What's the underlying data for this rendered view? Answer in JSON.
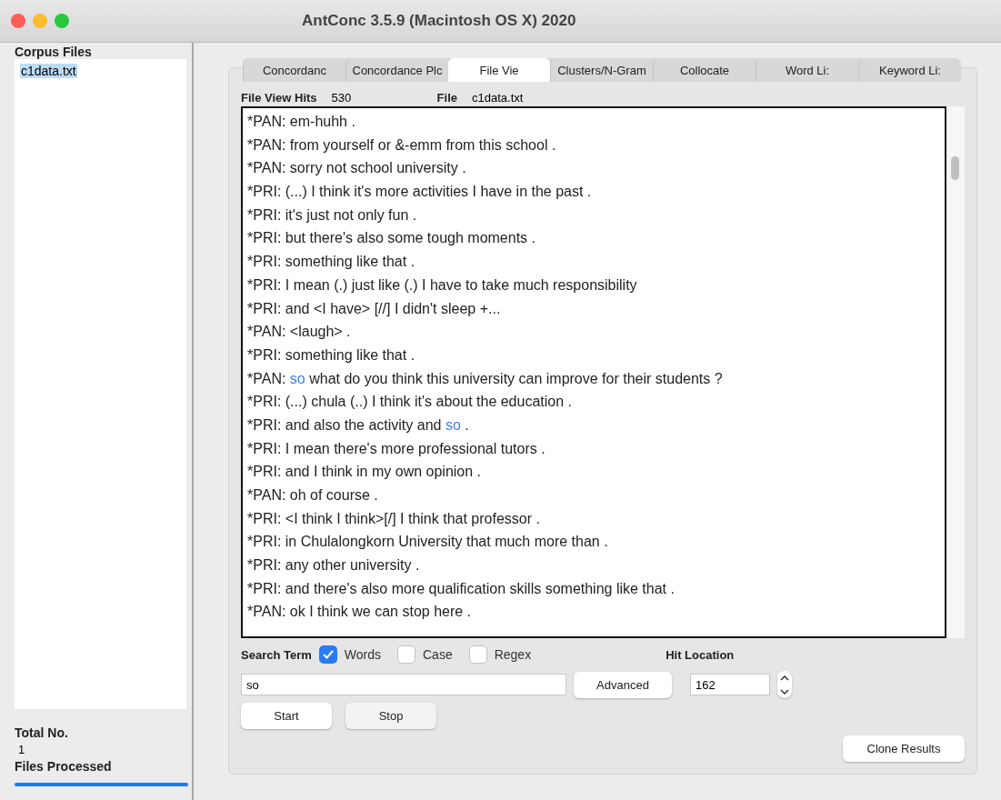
{
  "window": {
    "title": "AntConc 3.5.9 (Macintosh OS X) 2020"
  },
  "sidebar": {
    "heading": "Corpus Files",
    "files": [
      {
        "name": "c1data.txt",
        "selected": true
      }
    ],
    "total_label": "Total No.",
    "total_value": "1",
    "processed_label": "Files Processed",
    "progress": {
      "level": 1
    }
  },
  "tabs": [
    {
      "label": "Concordanc",
      "selected": false
    },
    {
      "label": "Concordance Plc",
      "selected": false
    },
    {
      "label": "File Vie",
      "selected": true
    },
    {
      "label": "Clusters/N-Gram",
      "selected": false
    },
    {
      "label": "Collocate",
      "selected": false
    },
    {
      "label": "Word Li:",
      "selected": false
    },
    {
      "label": "Keyword Li:",
      "selected": false
    }
  ],
  "info": {
    "hits_label": "File View Hits",
    "hits_value": "530",
    "file_label": "File",
    "file_value": "c1data.txt"
  },
  "lines": [
    [
      {
        "text": "*PAN: em-huhh .",
        "hit": false
      }
    ],
    [
      {
        "text": "*PAN: from yourself or &-emm from this school .",
        "hit": false
      }
    ],
    [
      {
        "text": "*PAN: sorry not school university .",
        "hit": false
      }
    ],
    [
      {
        "text": "*PRI: (...) I think it's more activities I have in the past .",
        "hit": false
      }
    ],
    [
      {
        "text": "*PRI: it's just not only fun .",
        "hit": false
      }
    ],
    [
      {
        "text": "*PRI: but there's also some tough moments .",
        "hit": false
      }
    ],
    [
      {
        "text": "*PRI: something like that .",
        "hit": false
      }
    ],
    [
      {
        "text": "*PRI: I mean (.) just like (.) I have to take much responsibility",
        "hit": false
      }
    ],
    [
      {
        "text": "*PRI: and <I have> [//] I didn't sleep +...",
        "hit": false
      }
    ],
    [
      {
        "text": "*PAN: <laugh> .",
        "hit": false
      }
    ],
    [
      {
        "text": "*PRI: something like that .",
        "hit": false
      }
    ],
    [
      {
        "text": "*PAN: ",
        "hit": false
      },
      {
        "text": "so",
        "hit": true
      },
      {
        "text": " what do you think this university can improve for their students ?",
        "hit": false
      }
    ],
    [
      {
        "text": "*PRI: (...) chula (..) I think it's about the education .",
        "hit": false
      }
    ],
    [
      {
        "text": "*PRI: and also the activity and ",
        "hit": false
      },
      {
        "text": "so",
        "hit": true
      },
      {
        "text": " .",
        "hit": false
      }
    ],
    [
      {
        "text": "*PRI: I mean there's more professional tutors .",
        "hit": false
      }
    ],
    [
      {
        "text": "*PRI: and I think in my own opinion .",
        "hit": false
      }
    ],
    [
      {
        "text": "*PAN: oh of course .",
        "hit": false
      }
    ],
    [
      {
        "text": "*PRI: <I think I think>[/] I think that professor .",
        "hit": false
      }
    ],
    [
      {
        "text": "*PRI: in Chulalongkorn University that much more than .",
        "hit": false
      }
    ],
    [
      {
        "text": "*PRI: any other university .",
        "hit": false
      }
    ],
    [
      {
        "text": "*PRI: and there's also more qualification skills something like that .",
        "hit": false
      }
    ],
    [
      {
        "text": "*PAN: ok I think we can stop here .",
        "hit": false
      }
    ]
  ],
  "search": {
    "label": "Search Term",
    "options": [
      {
        "label": "Words",
        "checked": true
      },
      {
        "label": "Case",
        "checked": false
      },
      {
        "label": "Regex",
        "checked": false
      }
    ],
    "value": "so",
    "advanced": "Advanced",
    "start": "Start",
    "stop": "Stop"
  },
  "hit_location": {
    "label": "Hit Location",
    "value": "162"
  },
  "clone": "Clone Results"
}
